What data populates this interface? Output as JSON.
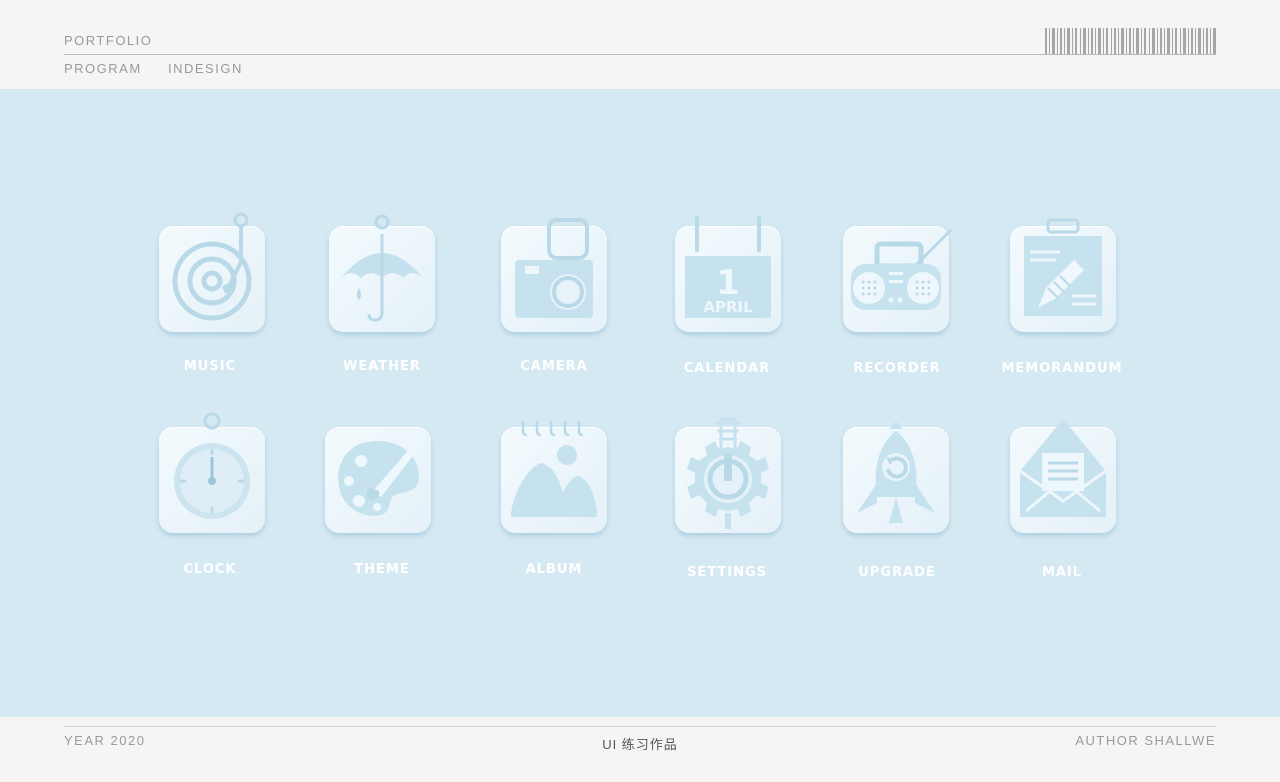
{
  "header": {
    "title": "PORTFOLIO",
    "nav": [
      "PROGRAM",
      "INDESIGN"
    ]
  },
  "icons": [
    {
      "label": "MUSIC",
      "icon": "record-player-icon"
    },
    {
      "label": "WEATHER",
      "icon": "umbrella-icon"
    },
    {
      "label": "CAMERA",
      "icon": "camera-icon"
    },
    {
      "label": "CALENDAR",
      "icon": "calendar-icon",
      "day": "1",
      "month": "APRIL"
    },
    {
      "label": "RECORDER",
      "icon": "radio-icon"
    },
    {
      "label": "MEMORANDUM",
      "icon": "memo-pencil-icon"
    },
    {
      "label": "CLOCK",
      "icon": "clock-icon"
    },
    {
      "label": "THEME",
      "icon": "palette-icon"
    },
    {
      "label": "ALBUM",
      "icon": "photo-album-icon"
    },
    {
      "label": "SETTINGS",
      "icon": "gear-icon"
    },
    {
      "label": "UPGRADE",
      "icon": "rocket-icon"
    },
    {
      "label": "MAIL",
      "icon": "envelope-icon"
    }
  ],
  "footer": {
    "year": "YEAR  2020",
    "center": "UI 练习作品",
    "author": "AUTHOR  SHALLWE"
  },
  "colors": {
    "background": "#d5e9f3",
    "tile": "#eaf4fa",
    "icon_line": "#b7d8e8",
    "label": "#ffffff"
  }
}
